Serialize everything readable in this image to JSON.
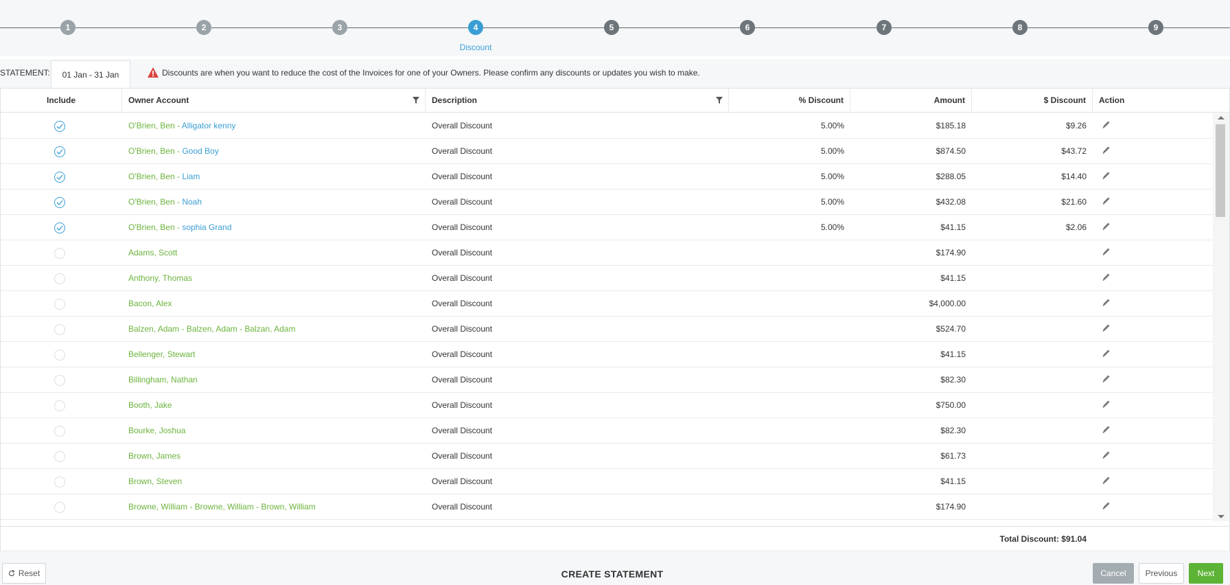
{
  "stepper": {
    "steps": [
      {
        "number": "1",
        "state": "done"
      },
      {
        "number": "2",
        "state": "done"
      },
      {
        "number": "3",
        "state": "done"
      },
      {
        "number": "4",
        "state": "active",
        "label": "Discount"
      },
      {
        "number": "5",
        "state": "upcoming"
      },
      {
        "number": "6",
        "state": "upcoming"
      },
      {
        "number": "7",
        "state": "upcoming"
      },
      {
        "number": "8",
        "state": "upcoming"
      },
      {
        "number": "9",
        "state": "upcoming"
      }
    ]
  },
  "statement": {
    "label": "STATEMENT:",
    "period_tab": "01 Jan - 31 Jan",
    "warning_icon": "warning-triangle-icon",
    "warning_text": "Discounts are when you want to reduce the cost of the Invoices for one of your Owners. Please confirm any discounts or updates you wish to make."
  },
  "table": {
    "columns": {
      "include": "Include",
      "owner": "Owner Account",
      "description": "Description",
      "pct_discount": "% Discount",
      "amount": "Amount",
      "usd_discount": "$ Discount",
      "action": "Action"
    },
    "rows": [
      {
        "included": true,
        "owner": "O'Brien, Ben - ",
        "pet": "Alligator kenny",
        "description": "Overall Discount",
        "pct": "5.00%",
        "amount": "$185.18",
        "discount": "$9.26"
      },
      {
        "included": true,
        "owner": "O'Brien, Ben - ",
        "pet": "Good Boy",
        "description": "Overall Discount",
        "pct": "5.00%",
        "amount": "$874.50",
        "discount": "$43.72"
      },
      {
        "included": true,
        "owner": "O'Brien, Ben - ",
        "pet": "Liam",
        "description": "Overall Discount",
        "pct": "5.00%",
        "amount": "$288.05",
        "discount": "$14.40"
      },
      {
        "included": true,
        "owner": "O'Brien, Ben - ",
        "pet": "Noah",
        "description": "Overall Discount",
        "pct": "5.00%",
        "amount": "$432.08",
        "discount": "$21.60"
      },
      {
        "included": true,
        "owner": "O'Brien, Ben - ",
        "pet": "sophia Grand",
        "description": "Overall Discount",
        "pct": "5.00%",
        "amount": "$41.15",
        "discount": "$2.06"
      },
      {
        "included": false,
        "owner": "Adams, Scott",
        "pet": "",
        "description": "Overall Discount",
        "pct": "",
        "amount": "$174.90",
        "discount": ""
      },
      {
        "included": false,
        "owner": "Anthony, Thomas",
        "pet": "",
        "description": "Overall Discount",
        "pct": "",
        "amount": "$41.15",
        "discount": ""
      },
      {
        "included": false,
        "owner": "Bacon, Alex",
        "pet": "",
        "description": "Overall Discount",
        "pct": "",
        "amount": "$4,000.00",
        "discount": ""
      },
      {
        "included": false,
        "owner": "Balzen, Adam - Balzen, Adam - Balzan, Adam",
        "pet": "",
        "description": "Overall Discount",
        "pct": "",
        "amount": "$524.70",
        "discount": ""
      },
      {
        "included": false,
        "owner": "Bellenger, Stewart",
        "pet": "",
        "description": "Overall Discount",
        "pct": "",
        "amount": "$41.15",
        "discount": ""
      },
      {
        "included": false,
        "owner": "Billingham, Nathan",
        "pet": "",
        "description": "Overall Discount",
        "pct": "",
        "amount": "$82.30",
        "discount": ""
      },
      {
        "included": false,
        "owner": "Booth, Jake",
        "pet": "",
        "description": "Overall Discount",
        "pct": "",
        "amount": "$750.00",
        "discount": ""
      },
      {
        "included": false,
        "owner": "Bourke, Joshua",
        "pet": "",
        "description": "Overall Discount",
        "pct": "",
        "amount": "$82.30",
        "discount": ""
      },
      {
        "included": false,
        "owner": "Brown, James",
        "pet": "",
        "description": "Overall Discount",
        "pct": "",
        "amount": "$61.73",
        "discount": ""
      },
      {
        "included": false,
        "owner": "Brown, Steven",
        "pet": "",
        "description": "Overall Discount",
        "pct": "",
        "amount": "$41.15",
        "discount": ""
      },
      {
        "included": false,
        "owner": "Browne, William - Browne, William - Brown, William",
        "pet": "",
        "description": "Overall Discount",
        "pct": "",
        "amount": "$174.90",
        "discount": ""
      }
    ],
    "total_label": "Total Discount: $91.04",
    "action_icon": "pencil-icon",
    "filter_icon": "filter-icon"
  },
  "footer": {
    "reset_label": "Reset",
    "title": "CREATE STATEMENT",
    "cancel_label": "Cancel",
    "previous_label": "Previous",
    "next_label": "Next"
  },
  "colors": {
    "accent_blue": "#3a9ed4",
    "owner_green": "#6bb33c",
    "next_green": "#5cb335",
    "warning_red": "#d9443f"
  }
}
